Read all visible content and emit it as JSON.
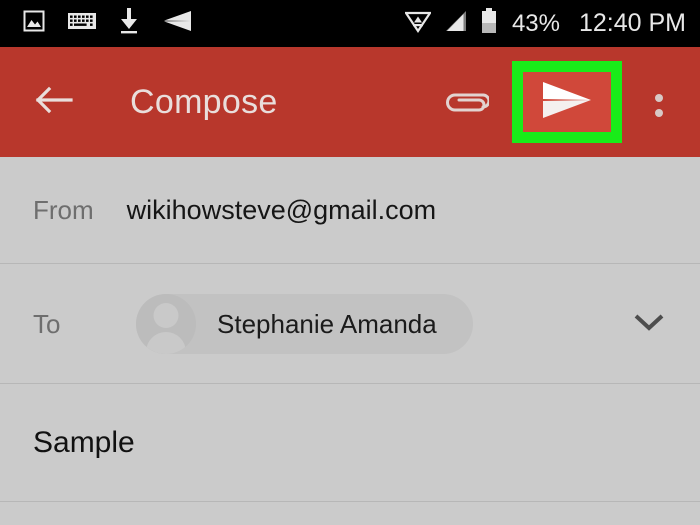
{
  "status_bar": {
    "icons_left": [
      "photo-icon",
      "keyboard-icon",
      "download-icon",
      "sent-mail-icon"
    ],
    "icons_right": [
      "wifi-icon",
      "signal-icon",
      "battery-icon"
    ],
    "battery_percent": "43%",
    "clock": "12:40 PM"
  },
  "app_bar": {
    "back_icon": "back-arrow-icon",
    "title": "Compose",
    "attach_icon": "paperclip-icon",
    "send_icon": "send-paper-plane-icon",
    "overflow_icon": "more-vertical-icon",
    "highlight_color": "#19ec19",
    "bar_color": "#b8372c"
  },
  "compose": {
    "from": {
      "label": "From",
      "value": "wikihowsteve@gmail.com"
    },
    "to": {
      "label": "To",
      "recipient": "Stephanie Amanda",
      "avatar_icon": "person-avatar-icon",
      "expand_icon": "chevron-down-icon"
    },
    "subject": {
      "value": "Sample"
    }
  }
}
